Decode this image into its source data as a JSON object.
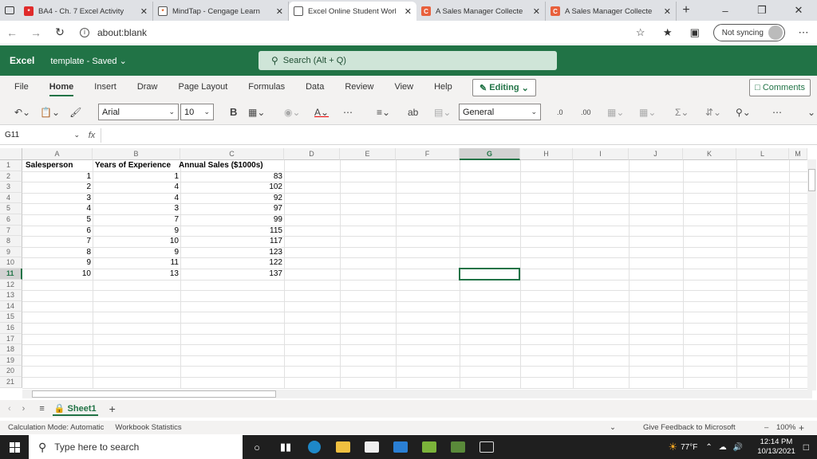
{
  "browser": {
    "tabs": [
      {
        "title": "BA4 - Ch. 7 Excel Activity",
        "color": "#e02b2b",
        "glyph": "*"
      },
      {
        "title": "MindTap - Cengage Learn",
        "color": "#ffffff",
        "glyph": "*"
      },
      {
        "title": "Excel Online Student Worl",
        "color": "#ffffff",
        "glyph": ""
      },
      {
        "title": "A Sales Manager Collecte",
        "color": "#e8603c",
        "glyph": "C"
      },
      {
        "title": "A Sales Manager Collecte",
        "color": "#e8603c",
        "glyph": "C"
      }
    ],
    "url": "about:blank",
    "sync_label": "Not syncing"
  },
  "excel": {
    "brand": "Excel",
    "doc_title": "template - Saved",
    "search_placeholder": "Search (Alt + Q)",
    "ribbon_tabs": [
      "File",
      "Home",
      "Insert",
      "Draw",
      "Page Layout",
      "Formulas",
      "Data",
      "Review",
      "View",
      "Help"
    ],
    "editing_label": "Editing",
    "comments_label": "Comments",
    "font_name": "Arial",
    "font_size": "10",
    "number_format": "General",
    "name_box": "G11",
    "columns": [
      "A",
      "B",
      "C",
      "D",
      "E",
      "F",
      "G",
      "H",
      "I",
      "J",
      "K",
      "L",
      "M"
    ],
    "rows": [
      "1",
      "2",
      "3",
      "4",
      "5",
      "6",
      "7",
      "8",
      "9",
      "10",
      "11",
      "12",
      "13",
      "14",
      "15",
      "16",
      "17",
      "18",
      "19",
      "20",
      "21"
    ],
    "headers": {
      "a": "Salesperson",
      "b": "Years of Experience",
      "c": "Annual Sales ($1000s)"
    },
    "data_rows": [
      {
        "a": "1",
        "b": "1",
        "c": "83"
      },
      {
        "a": "2",
        "b": "4",
        "c": "102"
      },
      {
        "a": "3",
        "b": "4",
        "c": "92"
      },
      {
        "a": "4",
        "b": "3",
        "c": "97"
      },
      {
        "a": "5",
        "b": "7",
        "c": "99"
      },
      {
        "a": "6",
        "b": "9",
        "c": "115"
      },
      {
        "a": "7",
        "b": "10",
        "c": "117"
      },
      {
        "a": "8",
        "b": "9",
        "c": "123"
      },
      {
        "a": "9",
        "b": "11",
        "c": "122"
      },
      {
        "a": "10",
        "b": "13",
        "c": "137"
      }
    ],
    "sheet_name": "Sheet1",
    "status": {
      "calc_mode": "Calculation Mode: Automatic",
      "workbook_stats": "Workbook Statistics",
      "feedback": "Give Feedback to Microsoft",
      "zoom": "100%"
    }
  },
  "taskbar": {
    "search_placeholder": "Type here to search",
    "weather": "77°F",
    "time": "12:14 PM",
    "date": "10/13/2021"
  }
}
